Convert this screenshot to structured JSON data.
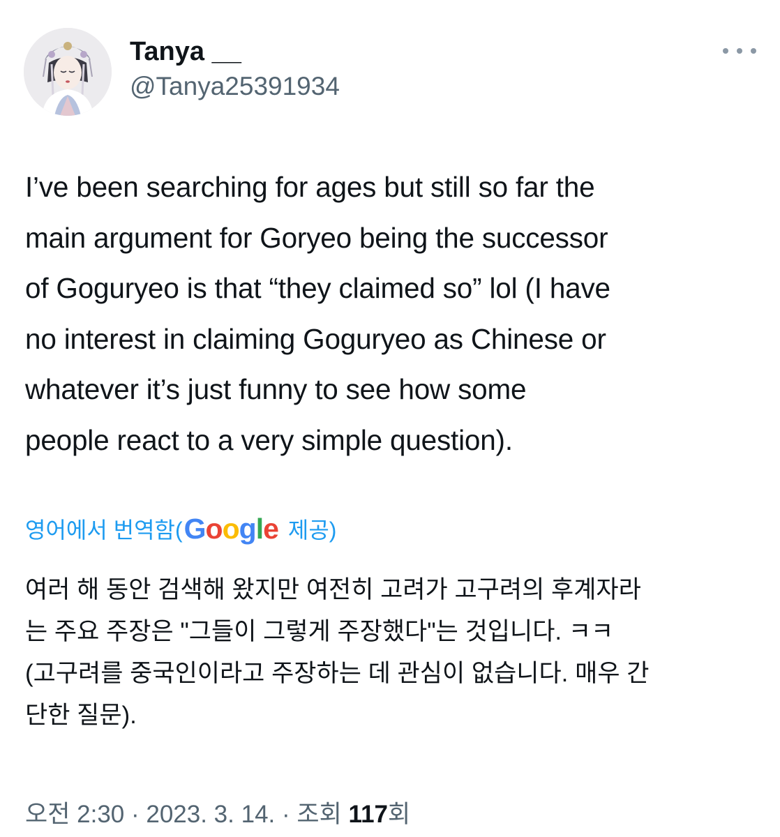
{
  "author": {
    "display_name": "Tanya __",
    "handle": "@Tanya25391934",
    "avatar_icon": "illustrated-portrait-avatar"
  },
  "more_icon": "ellipsis-icon",
  "tweet": {
    "text": "I’ve been searching for ages but still so far the\nmain argument for Goryeo being the successor\nof Goguryeo is that “they claimed so” lol (I have\nno interest in claiming Goguryeo as Chinese or\nwhatever it’s just funny to see how some\npeople react to a very simple question)."
  },
  "translation": {
    "label_prefix": "영어에서 번역함(",
    "brand": [
      "G",
      "o",
      "o",
      "g",
      "l",
      "e"
    ],
    "brand_colors": [
      "#4285f4",
      "#ea4335",
      "#fbbc05",
      "#4285f4",
      "#34a853",
      "#ea4335"
    ],
    "label_suffix": "제공)",
    "text": "여러 해 동안 검색해 왔지만 여전히 고려가 고구려의 후계자라\n는 주요 주장은 \"그들이 그렇게 주장했다\"는 것입니다. ㅋㅋ\n(고구려를 중국인이라고 주장하는 데 관심이 없습니다. 매우 간\n단한 질문)."
  },
  "meta": {
    "time": "오전 2:30",
    "separator": "·",
    "date": "2023. 3. 14.",
    "views_label": "조회",
    "views_count": "117",
    "views_suffix": "회"
  },
  "colors": {
    "link": "#1d9bf0",
    "secondary_text": "#536471",
    "primary_text": "#0f1419"
  }
}
